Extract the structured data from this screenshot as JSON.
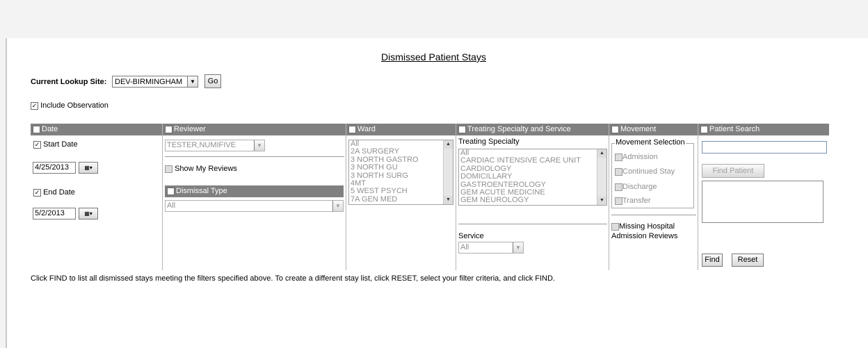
{
  "title": "Dismissed Patient Stays",
  "lookup": {
    "label": "Current Lookup Site:",
    "selected": "DEV-BIRMINGHAM",
    "go_label": "Go"
  },
  "include_observation": {
    "label": "Include Observation",
    "checked": true
  },
  "date": {
    "header": "Date",
    "start_label": "Start Date",
    "start_value": "4/25/2013",
    "end_label": "End Date",
    "end_value": "5/2/2013"
  },
  "reviewer": {
    "header": "Reviewer",
    "selected": "TESTER,NUMIFIVE",
    "show_my_reviews": "Show My Reviews",
    "dismissal_header": "Dismissal Type",
    "dismissal_selected": "All"
  },
  "ward": {
    "header": "Ward",
    "items": [
      "All",
      "2A SURGERY",
      "3 NORTH GASTRO",
      "3 NORTH GU",
      "3 NORTH SURG",
      "4MT",
      "5 WEST PSYCH",
      "7A GEN MED"
    ]
  },
  "specialty": {
    "header": "Treating Specialty and Service",
    "label": "Treating Specialty",
    "items": [
      "All",
      "CARDIAC INTENSIVE CARE UNIT",
      "CARDIOLOGY",
      "DOMICILLARY",
      "GASTROENTEROLOGY",
      "GEM ACUTE MEDICINE",
      "GEM NEUROLOGY"
    ],
    "service_label": "Service",
    "service_selected": "All"
  },
  "movement": {
    "header": "Movement",
    "group_label": "Movement Selection",
    "options": [
      "Admission",
      "Continued Stay",
      "Discharge",
      "Transfer"
    ],
    "missing_label_1": "Missing Hospital",
    "missing_label_2": "Admission Reviews"
  },
  "patient": {
    "header": "Patient Search",
    "find_patient_label": "Find Patient",
    "find_label": "Find",
    "reset_label": "Reset"
  },
  "footer_text": "Click FIND to list all dismissed stays meeting the filters specified above. To create a different stay list, click RESET, select your filter criteria, and click FIND."
}
